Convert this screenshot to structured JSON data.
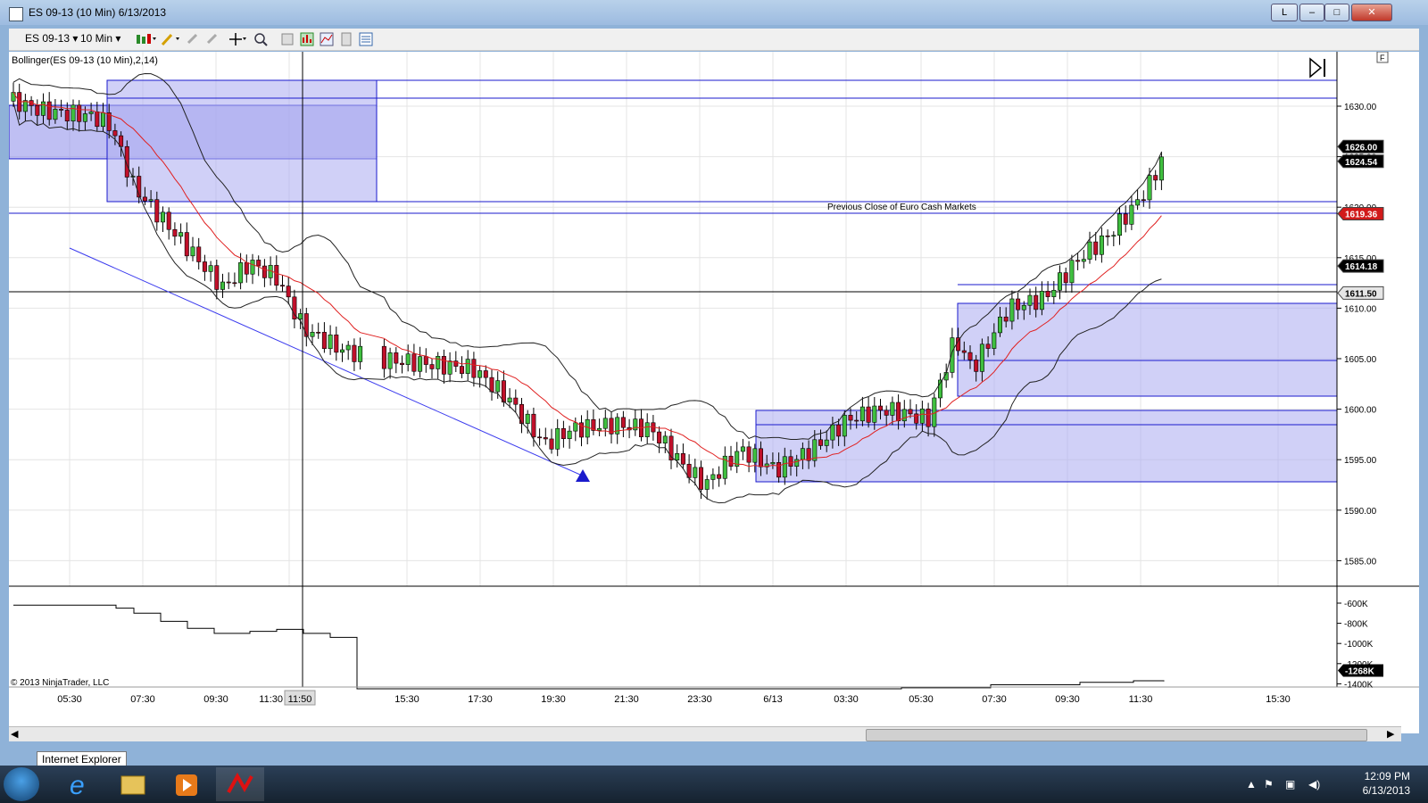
{
  "window": {
    "title": "ES 09-13 (10 Min)  6/13/2013",
    "min_label": "–",
    "restore_label": "□",
    "close_label": "✕",
    "l_label": "L"
  },
  "toolbar": {
    "instrument": "ES 09-13",
    "interval": "10 Min"
  },
  "chart": {
    "indicator_label": "Bollinger(ES 09-13 (10 Min),2,14)",
    "annotation": "Previous Close of Euro Cash Markets",
    "copyright": "© 2013 NinjaTrader, LLC",
    "f_label": "F",
    "price_ticks": [
      "1630.00",
      "1625.00",
      "1620.00",
      "1615.00",
      "1610.00",
      "1605.00",
      "1600.00",
      "1595.00",
      "1590.00",
      "1585.00"
    ],
    "price_flags": [
      {
        "label": "1626.00",
        "color": "#000000"
      },
      {
        "label": "1624.54",
        "color": "#000000"
      },
      {
        "label": "1619.36",
        "color": "#d11a1a"
      },
      {
        "label": "1614.18",
        "color": "#000000"
      },
      {
        "label": "1611.50",
        "color": "#e6e6e6"
      }
    ],
    "volume_ticks": [
      "-600K",
      "-800K",
      "-1000K",
      "-1200K",
      "-1400K"
    ],
    "volume_flag": "-1268K",
    "time_ticks": [
      "05:30",
      "07:30",
      "09:30",
      "11:30",
      "15:30",
      "17:30",
      "19:30",
      "21:30",
      "23:30",
      "6/13",
      "03:30",
      "05:30",
      "07:30",
      "09:30",
      "11:30",
      "15:30"
    ],
    "cursor_time": "11:50"
  },
  "tooltip": "Internet Explorer",
  "taskbar": {
    "time": "12:09 PM",
    "date": "6/13/2013"
  }
}
